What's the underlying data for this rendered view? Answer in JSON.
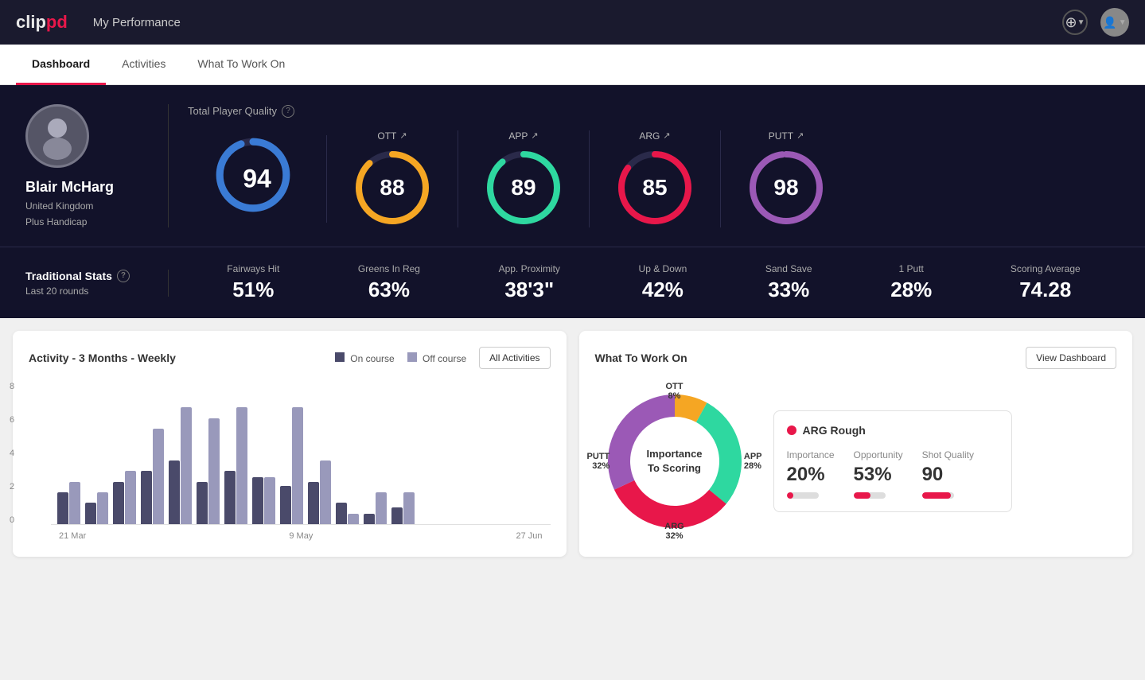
{
  "header": {
    "logo_clip": "clip",
    "logo_pd": "pd",
    "title": "My Performance",
    "add_label": "+",
    "avatar_label": "👤"
  },
  "nav": {
    "tabs": [
      {
        "label": "Dashboard",
        "active": true
      },
      {
        "label": "Activities",
        "active": false
      },
      {
        "label": "What To Work On",
        "active": false
      }
    ]
  },
  "player": {
    "name": "Blair McHarg",
    "country": "United Kingdom",
    "handicap": "Plus Handicap"
  },
  "quality": {
    "title": "Total Player Quality",
    "scores": [
      {
        "label": "94",
        "category": "TPQ",
        "color": "#3a7bd5",
        "percent": 94
      },
      {
        "label": "88",
        "category": "OTT",
        "color": "#f5a623",
        "percent": 88
      },
      {
        "label": "89",
        "category": "APP",
        "color": "#2ed8a0",
        "percent": 89
      },
      {
        "label": "85",
        "category": "ARG",
        "color": "#e8174a",
        "percent": 85
      },
      {
        "label": "98",
        "category": "PUTT",
        "color": "#9b59b6",
        "percent": 98
      }
    ]
  },
  "trad_stats": {
    "title": "Traditional Stats",
    "subtitle": "Last 20 rounds",
    "stats": [
      {
        "label": "Fairways Hit",
        "value": "51%"
      },
      {
        "label": "Greens In Reg",
        "value": "63%"
      },
      {
        "label": "App. Proximity",
        "value": "38'3\""
      },
      {
        "label": "Up & Down",
        "value": "42%"
      },
      {
        "label": "Sand Save",
        "value": "33%"
      },
      {
        "label": "1 Putt",
        "value": "28%"
      },
      {
        "label": "Scoring Average",
        "value": "74.28"
      }
    ]
  },
  "activity_chart": {
    "title": "Activity - 3 Months - Weekly",
    "legend_oncourse": "On course",
    "legend_offcourse": "Off course",
    "all_activities_btn": "All Activities",
    "x_labels": [
      "21 Mar",
      "9 May",
      "27 Jun"
    ],
    "y_labels": [
      "8",
      "6",
      "4",
      "2",
      "0"
    ],
    "bars": [
      {
        "on": 15,
        "off": 20
      },
      {
        "on": 10,
        "off": 15
      },
      {
        "on": 20,
        "off": 25
      },
      {
        "on": 25,
        "off": 45
      },
      {
        "on": 30,
        "off": 55
      },
      {
        "on": 20,
        "off": 50
      },
      {
        "on": 25,
        "off": 55
      },
      {
        "on": 22,
        "off": 22
      },
      {
        "on": 18,
        "off": 55
      },
      {
        "on": 20,
        "off": 30
      },
      {
        "on": 10,
        "off": 5
      },
      {
        "on": 5,
        "off": 15
      },
      {
        "on": 8,
        "off": 15
      }
    ]
  },
  "what_to_work": {
    "title": "What To Work On",
    "view_dashboard_btn": "View Dashboard",
    "center_text_line1": "Importance",
    "center_text_line2": "To Scoring",
    "segments": [
      {
        "label": "OTT",
        "value": "8%",
        "color": "#f5a623"
      },
      {
        "label": "APP",
        "value": "28%",
        "color": "#2ed8a0"
      },
      {
        "label": "ARG",
        "value": "32%",
        "color": "#e8174a"
      },
      {
        "label": "PUTT",
        "value": "32%",
        "color": "#9b59b6"
      }
    ],
    "arg_card": {
      "title": "ARG Rough",
      "stats": [
        {
          "label": "Importance",
          "value": "20%",
          "bar_pct": 20
        },
        {
          "label": "Opportunity",
          "value": "53%",
          "bar_pct": 53
        },
        {
          "label": "Shot Quality",
          "value": "90",
          "bar_pct": 90
        }
      ]
    }
  }
}
